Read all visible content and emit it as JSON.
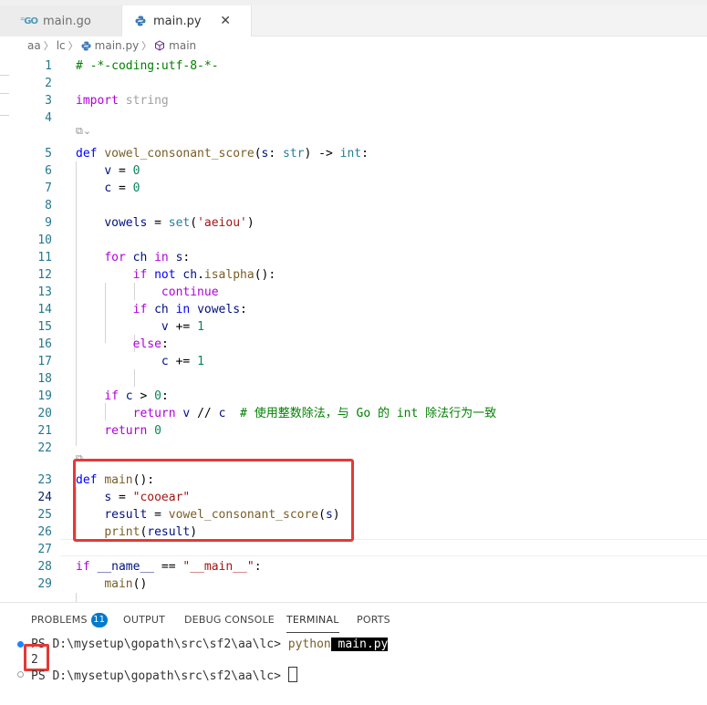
{
  "tabs": [
    {
      "label": "main.go",
      "icon": "go-file-icon",
      "active": false
    },
    {
      "label": "main.py",
      "icon": "python-file-icon",
      "active": true,
      "close": "✕"
    }
  ],
  "breadcrumb": [
    "aa",
    "lc",
    "main.py",
    "main"
  ],
  "code_lines": [
    {
      "n": "1",
      "segs": [
        [
          "cm",
          "# -*-coding:utf-8-*-"
        ]
      ]
    },
    {
      "n": "2",
      "segs": []
    },
    {
      "n": "3",
      "segs": [
        [
          "kwc",
          "import"
        ],
        [
          "op",
          " "
        ],
        [
          "dim",
          "string"
        ]
      ]
    },
    {
      "n": "4",
      "segs": []
    },
    {
      "n": "5",
      "segs": [
        [
          "kw",
          "def"
        ],
        [
          "op",
          " "
        ],
        [
          "fn",
          "vowel_consonant_score"
        ],
        [
          "op",
          "("
        ],
        [
          "var",
          "s"
        ],
        [
          "op",
          ": "
        ],
        [
          "ty",
          "str"
        ],
        [
          "op",
          ") -> "
        ],
        [
          "ty",
          "int"
        ],
        [
          "op",
          ":"
        ]
      ]
    },
    {
      "n": "6",
      "segs": [
        [
          "op",
          "    "
        ],
        [
          "var",
          "v"
        ],
        [
          "op",
          " = "
        ],
        [
          "num",
          "0"
        ]
      ]
    },
    {
      "n": "7",
      "segs": [
        [
          "op",
          "    "
        ],
        [
          "var",
          "c"
        ],
        [
          "op",
          " = "
        ],
        [
          "num",
          "0"
        ]
      ]
    },
    {
      "n": "8",
      "segs": []
    },
    {
      "n": "9",
      "segs": [
        [
          "op",
          "    "
        ],
        [
          "var",
          "vowels"
        ],
        [
          "op",
          " = "
        ],
        [
          "ty",
          "set"
        ],
        [
          "op",
          "("
        ],
        [
          "str",
          "'aeiou'"
        ],
        [
          "op",
          ")"
        ]
      ]
    },
    {
      "n": "10",
      "segs": []
    },
    {
      "n": "11",
      "segs": [
        [
          "op",
          "    "
        ],
        [
          "kwc",
          "for"
        ],
        [
          "op",
          " "
        ],
        [
          "var",
          "ch"
        ],
        [
          "op",
          " "
        ],
        [
          "kwc",
          "in"
        ],
        [
          "op",
          " "
        ],
        [
          "var",
          "s"
        ],
        [
          "op",
          ":"
        ]
      ]
    },
    {
      "n": "12",
      "segs": [
        [
          "op",
          "        "
        ],
        [
          "kwc",
          "if"
        ],
        [
          "op",
          " "
        ],
        [
          "kw",
          "not"
        ],
        [
          "op",
          " "
        ],
        [
          "var",
          "ch"
        ],
        [
          "op",
          "."
        ],
        [
          "fn",
          "isalpha"
        ],
        [
          "op",
          "():"
        ]
      ]
    },
    {
      "n": "13",
      "segs": [
        [
          "op",
          "            "
        ],
        [
          "kwc",
          "continue"
        ]
      ]
    },
    {
      "n": "14",
      "segs": [
        [
          "op",
          "        "
        ],
        [
          "kwc",
          "if"
        ],
        [
          "op",
          " "
        ],
        [
          "var",
          "ch"
        ],
        [
          "op",
          " "
        ],
        [
          "kw",
          "in"
        ],
        [
          "op",
          " "
        ],
        [
          "var",
          "vowels"
        ],
        [
          "op",
          ":"
        ]
      ]
    },
    {
      "n": "15",
      "segs": [
        [
          "op",
          "            "
        ],
        [
          "var",
          "v"
        ],
        [
          "op",
          " += "
        ],
        [
          "num",
          "1"
        ]
      ]
    },
    {
      "n": "16",
      "segs": [
        [
          "op",
          "        "
        ],
        [
          "kwc",
          "else"
        ],
        [
          "op",
          ":"
        ]
      ]
    },
    {
      "n": "17",
      "segs": [
        [
          "op",
          "            "
        ],
        [
          "var",
          "c"
        ],
        [
          "op",
          " += "
        ],
        [
          "num",
          "1"
        ]
      ]
    },
    {
      "n": "18",
      "segs": []
    },
    {
      "n": "19",
      "segs": [
        [
          "op",
          "    "
        ],
        [
          "kwc",
          "if"
        ],
        [
          "op",
          " "
        ],
        [
          "var",
          "c"
        ],
        [
          "op",
          " > "
        ],
        [
          "num",
          "0"
        ],
        [
          "op",
          ":"
        ]
      ]
    },
    {
      "n": "20",
      "segs": [
        [
          "op",
          "        "
        ],
        [
          "kwc",
          "return"
        ],
        [
          "op",
          " "
        ],
        [
          "var",
          "v"
        ],
        [
          "op",
          " // "
        ],
        [
          "var",
          "c"
        ],
        [
          "op",
          "  "
        ],
        [
          "cm",
          "# 使用整数除法，与 Go 的 int 除法行为一致"
        ]
      ]
    },
    {
      "n": "21",
      "segs": [
        [
          "op",
          "    "
        ],
        [
          "kwc",
          "return"
        ],
        [
          "op",
          " "
        ],
        [
          "num",
          "0"
        ]
      ]
    },
    {
      "n": "22",
      "segs": []
    },
    {
      "n": "23",
      "segs": [
        [
          "kw",
          "def"
        ],
        [
          "op",
          " "
        ],
        [
          "fn",
          "main"
        ],
        [
          "op",
          "():"
        ]
      ]
    },
    {
      "n": "24",
      "segs": [
        [
          "op",
          "    "
        ],
        [
          "var",
          "s"
        ],
        [
          "op",
          " = "
        ],
        [
          "str",
          "\"cooear\""
        ]
      ]
    },
    {
      "n": "25",
      "segs": [
        [
          "op",
          "    "
        ],
        [
          "var",
          "result"
        ],
        [
          "op",
          " = "
        ],
        [
          "fn",
          "vowel_consonant_score"
        ],
        [
          "op",
          "("
        ],
        [
          "var",
          "s"
        ],
        [
          "op",
          ")"
        ]
      ]
    },
    {
      "n": "26",
      "segs": [
        [
          "op",
          "    "
        ],
        [
          "fn",
          "print"
        ],
        [
          "op",
          "("
        ],
        [
          "var",
          "result"
        ],
        [
          "op",
          ")"
        ]
      ]
    },
    {
      "n": "27",
      "segs": []
    },
    {
      "n": "28",
      "segs": [
        [
          "kwc",
          "if"
        ],
        [
          "op",
          " "
        ],
        [
          "var",
          "__name__"
        ],
        [
          "op",
          " == "
        ],
        [
          "str",
          "\"__main__\""
        ],
        [
          "op",
          ":"
        ]
      ]
    },
    {
      "n": "29",
      "segs": [
        [
          "op",
          "    "
        ],
        [
          "fn",
          "main"
        ],
        [
          "op",
          "()"
        ]
      ]
    }
  ],
  "panel": {
    "tabs": [
      "PROBLEMS",
      "OUTPUT",
      "DEBUG CONSOLE",
      "TERMINAL",
      "PORTS"
    ],
    "problems_count": "11",
    "active_tab": "TERMINAL"
  },
  "terminal": {
    "prompt1": "PS D:\\mysetup\\gopath\\src\\sf2\\aa\\lc> ",
    "cmd": "python",
    "arg": " main.py",
    "output": "2",
    "prompt2": "PS D:\\mysetup\\gopath\\src\\sf2\\aa\\lc> "
  },
  "colors": {
    "keyword": "#0000ff",
    "control": "#af00db",
    "function": "#795e26",
    "variable": "#001080",
    "string": "#a31515",
    "number": "#098658",
    "comment": "#008000",
    "annotation_red": "#e53935",
    "badge": "#007acc"
  }
}
